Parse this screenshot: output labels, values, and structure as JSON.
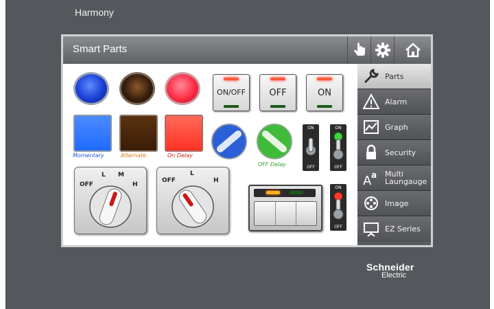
{
  "device": {
    "brand_top": "Harmony",
    "maker_logo_line1": "Schneider",
    "maker_logo_line2": "Electric"
  },
  "screen": {
    "title": "Smart Parts",
    "title_buttons": [
      {
        "icon": "touch-hand-icon"
      },
      {
        "icon": "gear-icon"
      },
      {
        "icon": "home-icon"
      }
    ]
  },
  "sidebar": {
    "items": [
      {
        "label": "Parts",
        "icon": "wrench-icon",
        "active": true
      },
      {
        "label": "Alarm",
        "icon": "warning-icon",
        "active": false
      },
      {
        "label": "Graph",
        "icon": "graph-icon",
        "active": false
      },
      {
        "label": "Security",
        "icon": "lock-icon",
        "active": false
      },
      {
        "label_line1": "Multi",
        "label_line2": "Laungauge",
        "icon": "font-aa-icon",
        "active": false
      },
      {
        "label": "Image",
        "icon": "film-reel-icon",
        "active": false
      },
      {
        "label": "EZ Series",
        "icon": "presentation-icon",
        "active": false
      }
    ]
  },
  "parts": {
    "pilot_lamps": [
      {
        "color": "#1a3fd6"
      },
      {
        "color": "#3a1f0e"
      },
      {
        "color": "#ff2c45"
      }
    ],
    "push_buttons": [
      {
        "color": "#1f6bff",
        "caption": "Momentary",
        "caption_color": "#1f55d6"
      },
      {
        "color": "#4a2808",
        "caption": "Alternate",
        "caption_color": "#d9781a"
      },
      {
        "color": "#ff3224",
        "caption": "On Delay",
        "caption_color": "#cc1b1b"
      }
    ],
    "illuminated_switches": [
      {
        "label": "ON/OFF"
      },
      {
        "label": "OFF"
      },
      {
        "label": "ON"
      }
    ],
    "selector_buttons": [
      {
        "color": "#2a5fd8",
        "caption": ""
      },
      {
        "color": "#3fbb3a",
        "caption": "OFF Delay",
        "caption_color": "#2e9e2e"
      }
    ],
    "toggles": [
      {
        "on": "ON",
        "off": "OFF",
        "lamp": "none"
      },
      {
        "on": "ON",
        "off": "OFF",
        "lamp": "green"
      },
      {
        "on": "ON",
        "off": "OFF",
        "lamp": "red"
      }
    ],
    "rotary_4": {
      "labels": [
        "OFF",
        "L",
        "M",
        "H"
      ]
    },
    "rotary_3": {
      "labels": [
        "OFF",
        "L",
        "H"
      ]
    }
  }
}
